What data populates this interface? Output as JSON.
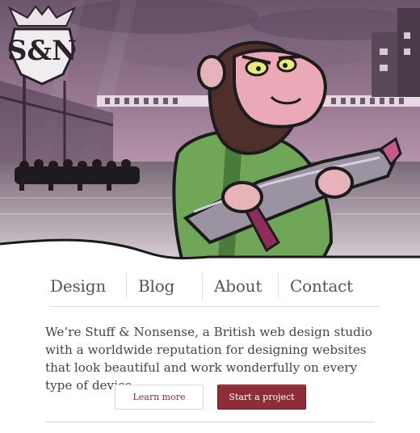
{
  "nav": {
    "items": [
      {
        "label": "Design"
      },
      {
        "label": "Blog"
      },
      {
        "label": "About"
      },
      {
        "label": "Contact"
      }
    ]
  },
  "intro": {
    "text": "We’re Stuff & Nonsense, a British web design studio with a worldwide reputation for designing websites that look beautiful and work wonderfully on every type of device."
  },
  "buttons": {
    "learn_more": "Learn more",
    "start_project": "Start a project"
  },
  "colors": {
    "accent": "#8e2d37",
    "sky_top": "#6e5a70",
    "sky_bottom": "#c9a4bd"
  }
}
